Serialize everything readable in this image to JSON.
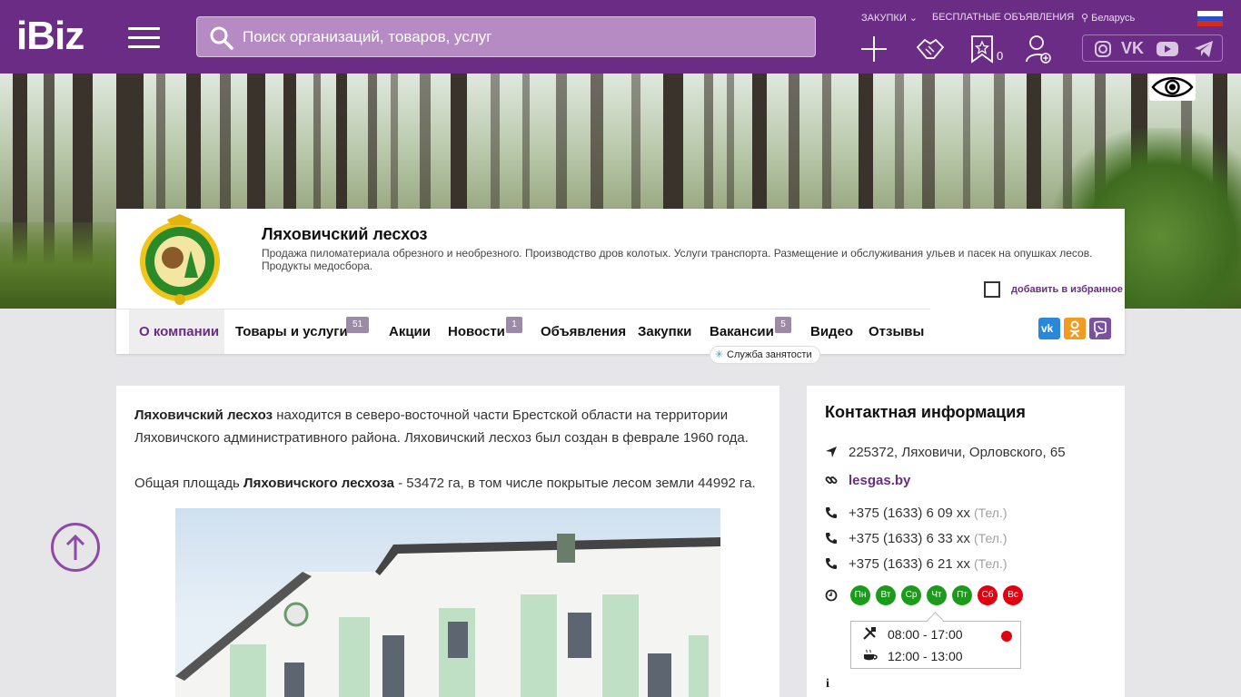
{
  "header": {
    "logo": "iBiz",
    "search_placeholder": "Поиск организаций, товаров, услуг",
    "links": {
      "purchases": "ЗАКУПКИ",
      "free_ads": "БЕСПЛАТНЫЕ ОБЪЯВЛЕНИЯ",
      "region": "Беларусь"
    },
    "favorites_count": "0",
    "accent_color": "#6a2c85"
  },
  "company": {
    "name": "Ляховичский лесхоз",
    "description": "Продажа пиломатериала обрезного и необрезного. Производство дров колотых. Услуги транспорта. Размещение и обслуживания ульев и пасек на опушках лесов. Продукты медосбора.",
    "add_favorite": "добавить в избранное"
  },
  "tabs": [
    {
      "label": "О компании",
      "badge": ""
    },
    {
      "label": "Товары и услуги",
      "badge": "51"
    },
    {
      "label": "Акции",
      "badge": ""
    },
    {
      "label": "Новости",
      "badge": "1"
    },
    {
      "label": "Объявления",
      "badge": ""
    },
    {
      "label": "Закупки",
      "badge": ""
    },
    {
      "label": "Вакансии",
      "badge": "5"
    },
    {
      "label": "Видео",
      "badge": ""
    },
    {
      "label": "Отзывы",
      "badge": ""
    }
  ],
  "employment_tag": "Служба занятости",
  "about": {
    "p1_bold": "Ляховичский лесхоз",
    "p1_text": "  находится в северо-восточной части Брестской области на территории Ляховичского административного района. Ляховичский лесхоз был создан в феврале 1960 года.",
    "p2_a": "Общая площадь ",
    "p2_bold": "Ляховичского лесхоза",
    "p2_b": " - 53472 га, в том числе покрытые лесом земли 44992 га."
  },
  "contact": {
    "title": "Контактная информация",
    "address": "225372, Ляховичи, Орловского, 65",
    "site": "lesgas.by",
    "phones": [
      {
        "number": "+375 (1633) 6 09 хх",
        "type": "(Тел.)"
      },
      {
        "number": "+375 (1633) 6 33 хх",
        "type": "(Тел.)"
      },
      {
        "number": "+375 (1633) 6 21 хх",
        "type": "(Тел.)"
      }
    ],
    "days": [
      {
        "label": "Пн",
        "color": "#1a9c1a"
      },
      {
        "label": "Вт",
        "color": "#1a9c1a"
      },
      {
        "label": "Ср",
        "color": "#1a9c1a"
      },
      {
        "label": "Чт",
        "color": "#1a9c1a"
      },
      {
        "label": "Пт",
        "color": "#1a9c1a"
      },
      {
        "label": "Сб",
        "color": "#e0000f"
      },
      {
        "label": "Вс",
        "color": "#e0000f"
      }
    ],
    "work_hours": "08:00 - 17:00",
    "lunch_hours": "12:00 - 13:00"
  }
}
